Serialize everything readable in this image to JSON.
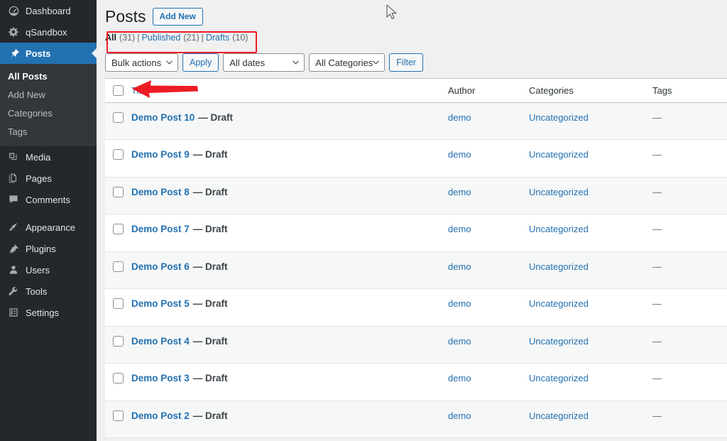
{
  "sidebar": {
    "items": [
      {
        "label": "Dashboard",
        "icon": "dashboard-icon",
        "state": "normal"
      },
      {
        "label": "qSandbox",
        "icon": "gear-icon",
        "state": "normal"
      },
      {
        "label": "Posts",
        "icon": "pin-icon",
        "state": "current"
      },
      {
        "label": "Media",
        "icon": "media-icon",
        "state": "normal"
      },
      {
        "label": "Pages",
        "icon": "pages-icon",
        "state": "normal"
      },
      {
        "label": "Comments",
        "icon": "comment-icon",
        "state": "normal"
      },
      {
        "label": "Appearance",
        "icon": "brush-icon",
        "state": "normal"
      },
      {
        "label": "Plugins",
        "icon": "plug-icon",
        "state": "normal"
      },
      {
        "label": "Users",
        "icon": "user-icon",
        "state": "normal"
      },
      {
        "label": "Tools",
        "icon": "wrench-icon",
        "state": "normal"
      },
      {
        "label": "Settings",
        "icon": "settings-icon",
        "state": "normal"
      }
    ],
    "submenu": [
      {
        "label": "All Posts",
        "state": "current"
      },
      {
        "label": "Add New",
        "state": "normal"
      },
      {
        "label": "Categories",
        "state": "normal"
      },
      {
        "label": "Tags",
        "state": "normal"
      }
    ]
  },
  "header": {
    "title": "Posts",
    "add_new_label": "Add New"
  },
  "status_links": {
    "all_label": "All",
    "all_count": "(31)",
    "published_label": "Published",
    "published_count": "(21)",
    "drafts_label": "Drafts",
    "drafts_count": "(10)",
    "separator": "|"
  },
  "toolbar": {
    "bulk_actions_value": "Bulk actions",
    "apply_label": "Apply",
    "dates_value": "All dates",
    "categories_value": "All Categories",
    "filter_label": "Filter"
  },
  "table": {
    "columns": {
      "title": "Title",
      "author": "Author",
      "categories": "Categories",
      "tags": "Tags"
    },
    "rows": [
      {
        "title": "Demo Post 10",
        "status": "— Draft",
        "author": "demo",
        "categories": "Uncategorized",
        "tags": "—"
      },
      {
        "title": "Demo Post 9",
        "status": "— Draft",
        "author": "demo",
        "categories": "Uncategorized",
        "tags": "—"
      },
      {
        "title": "Demo Post 8",
        "status": "— Draft",
        "author": "demo",
        "categories": "Uncategorized",
        "tags": "—"
      },
      {
        "title": "Demo Post 7",
        "status": "— Draft",
        "author": "demo",
        "categories": "Uncategorized",
        "tags": "—"
      },
      {
        "title": "Demo Post 6",
        "status": "— Draft",
        "author": "demo",
        "categories": "Uncategorized",
        "tags": "—"
      },
      {
        "title": "Demo Post 5",
        "status": "— Draft",
        "author": "demo",
        "categories": "Uncategorized",
        "tags": "—"
      },
      {
        "title": "Demo Post 4",
        "status": "— Draft",
        "author": "demo",
        "categories": "Uncategorized",
        "tags": "—"
      },
      {
        "title": "Demo Post 3",
        "status": "— Draft",
        "author": "demo",
        "categories": "Uncategorized",
        "tags": "—"
      },
      {
        "title": "Demo Post 2",
        "status": "— Draft",
        "author": "demo",
        "categories": "Uncategorized",
        "tags": "—"
      }
    ]
  },
  "annotations": {
    "box_color": "#ed1c24",
    "arrow_color": "#ed1c24",
    "arrow_target": "All Posts",
    "box_target": "status-links"
  },
  "colors": {
    "accent_blue": "#2271b1",
    "sidebar_bg": "#23282d",
    "submenu_bg": "#32373c",
    "page_bg": "#f0f0f1",
    "row_alt_bg": "#f6f7f7"
  }
}
